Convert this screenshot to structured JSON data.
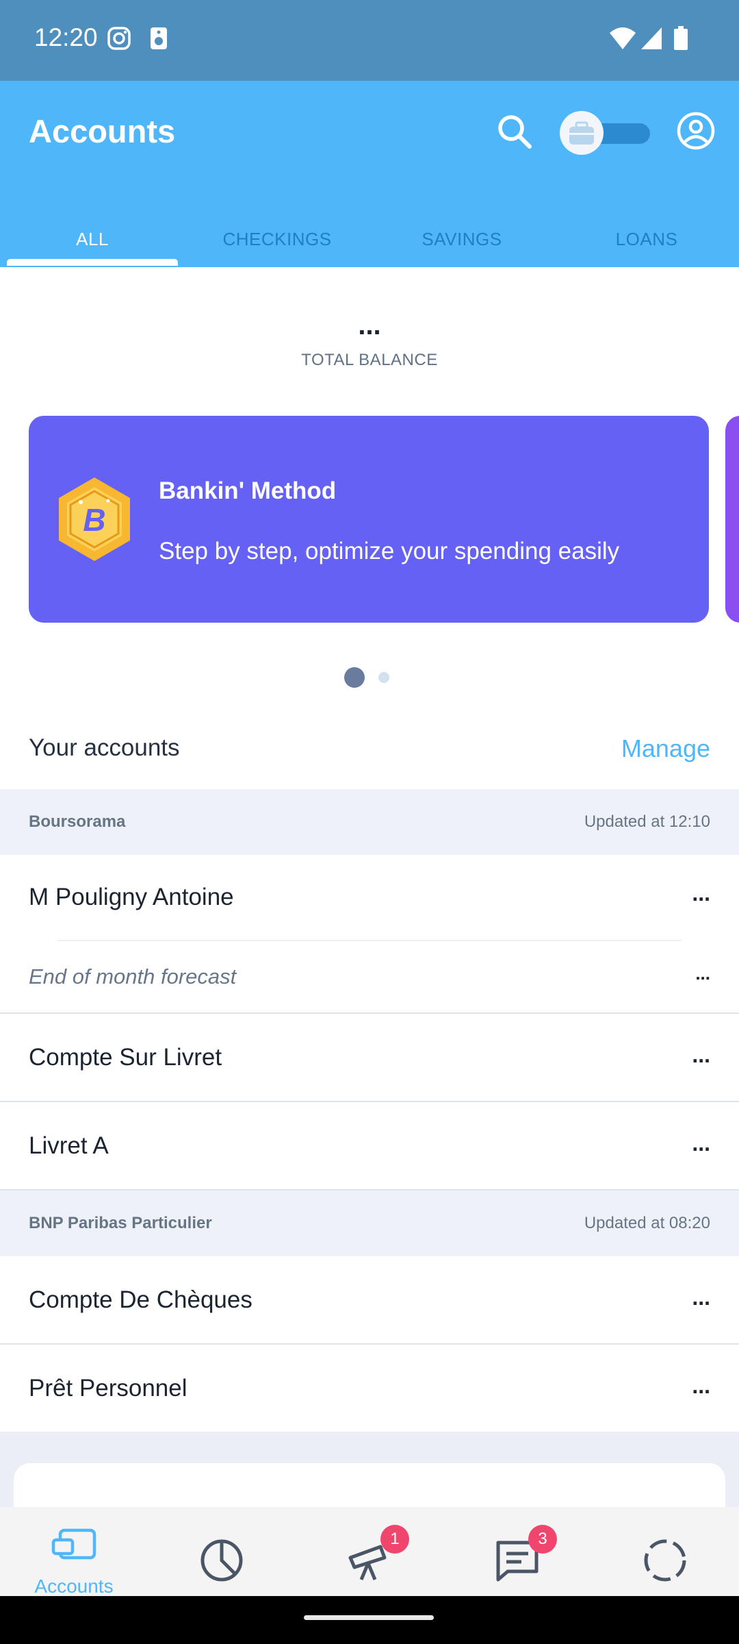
{
  "status_bar": {
    "time": "12:20",
    "icons": [
      "instagram-icon",
      "media-icon",
      "wifi-icon",
      "signal-icon",
      "battery-icon"
    ]
  },
  "app_bar": {
    "title": "Accounts",
    "actions": [
      "search-icon",
      "business-toggle",
      "profile-icon"
    ]
  },
  "tabs": [
    {
      "label": "ALL",
      "active": true
    },
    {
      "label": "CHECKINGS",
      "active": false
    },
    {
      "label": "SAVINGS",
      "active": false
    },
    {
      "label": "LOANS",
      "active": false
    }
  ],
  "balance": {
    "value": "...",
    "label": "TOTAL BALANCE"
  },
  "promo": {
    "title": "Bankin' Method",
    "subtitle": "Step by step, optimize your spending easily",
    "badge_letter": "B",
    "page_count": 2,
    "active_page": 1
  },
  "accounts_section": {
    "title": "Your accounts",
    "manage_label": "Manage"
  },
  "banks": [
    {
      "name": "Boursorama",
      "updated": "Updated at 12:10",
      "accounts": [
        {
          "name": "M Pouligny Antoine",
          "balance": "...",
          "forecast_label": "End of month forecast",
          "forecast_value": "..."
        },
        {
          "name": "Compte Sur Livret",
          "balance": "..."
        },
        {
          "name": "Livret A",
          "balance": "..."
        }
      ]
    },
    {
      "name": "BNP Paribas Particulier",
      "updated": "Updated at 08:20",
      "accounts": [
        {
          "name": "Compte De Chèques",
          "balance": "..."
        },
        {
          "name": "Prêt Personnel",
          "balance": "..."
        }
      ]
    }
  ],
  "bottom_nav": [
    {
      "label": "Accounts",
      "icon": "accounts-icon",
      "active": true
    },
    {
      "label": "",
      "icon": "analysis-pie-icon",
      "active": false
    },
    {
      "label": "",
      "icon": "telescope-icon",
      "badge": "1",
      "active": false
    },
    {
      "label": "",
      "icon": "messages-icon",
      "badge": "3",
      "active": false
    },
    {
      "label": "",
      "icon": "loading-circle-icon",
      "active": false
    }
  ],
  "colors": {
    "status_bar": "#4f8fbe",
    "app_bar": "#4fb7f9",
    "promo_card": "#6561f5",
    "accent": "#4fb7f9",
    "badge": "#f0466e"
  }
}
